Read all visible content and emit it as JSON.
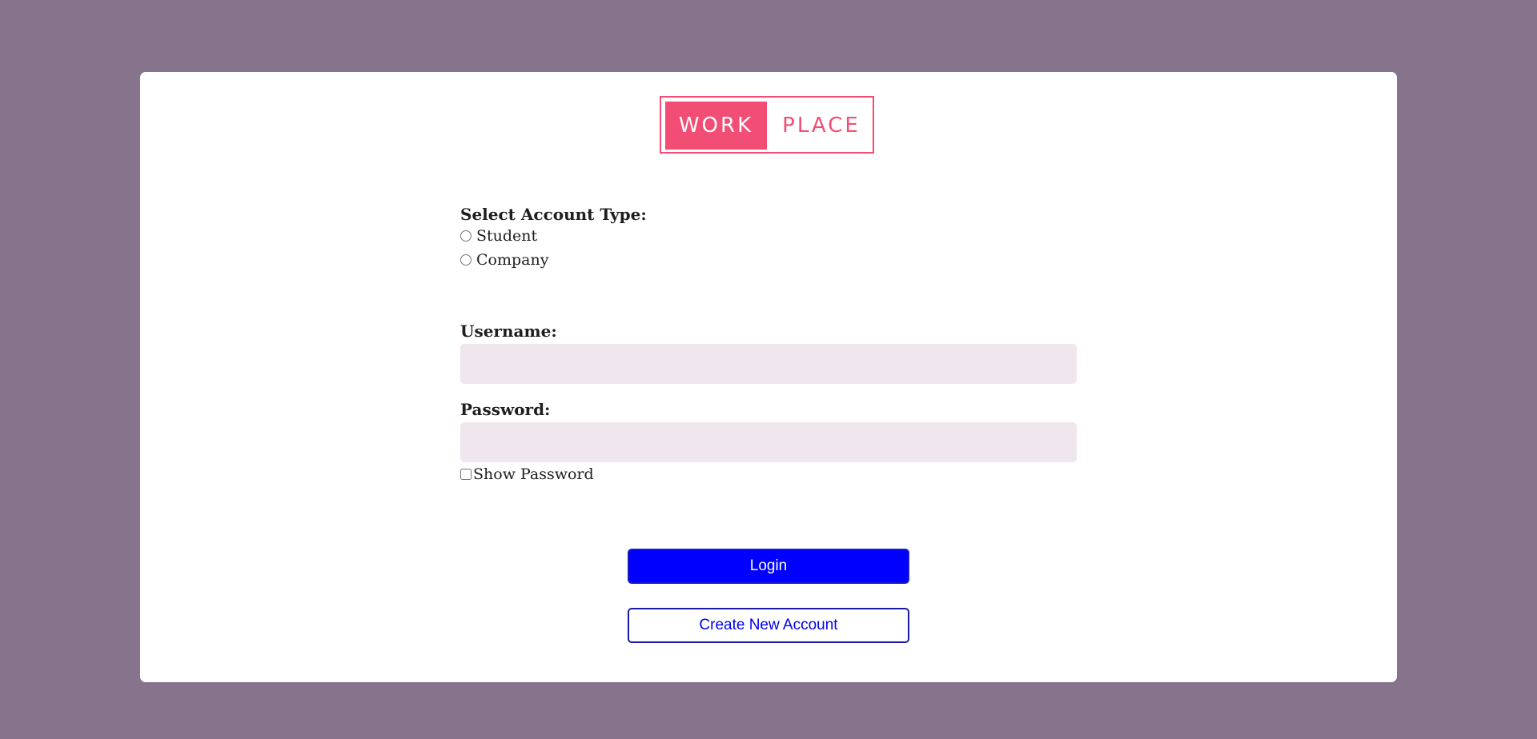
{
  "logo": {
    "word1": "WORK",
    "word2": "PLACE",
    "brand_color": "#f24d74"
  },
  "account_type": {
    "label": "Select Account Type:",
    "options": [
      "Student",
      "Company"
    ],
    "selected": null
  },
  "username": {
    "label": "Username:",
    "value": "",
    "placeholder": ""
  },
  "password": {
    "label": "Password:",
    "value": "",
    "placeholder": "",
    "show_password_label": "Show Password",
    "show_password_checked": false
  },
  "buttons": {
    "login": "Login",
    "create_account": "Create New Account"
  },
  "colors": {
    "page_background": "#86738c",
    "card_background": "#ffffff",
    "input_background": "#f0e6ee",
    "login_button": "#0000ff"
  }
}
